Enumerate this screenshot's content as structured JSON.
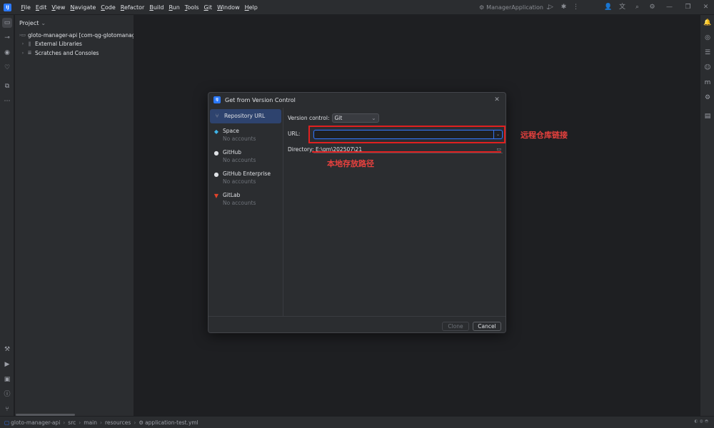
{
  "menu": [
    "File",
    "Edit",
    "View",
    "Navigate",
    "Code",
    "Refactor",
    "Build",
    "Run",
    "Tools",
    "Git",
    "Window",
    "Help"
  ],
  "run_config": "ManagerApplication",
  "project_panel": {
    "title": "Project",
    "tree": [
      {
        "label": "gloto-manager-api [com-qg-glotomanag",
        "icon": "folder-icon"
      },
      {
        "label": "External Libraries",
        "icon": "library-icon"
      },
      {
        "label": "Scratches and Consoles",
        "icon": "scratches-icon"
      }
    ]
  },
  "dialog": {
    "title": "Get from Version Control",
    "sources": [
      {
        "name": "Repository URL",
        "sub": "",
        "icon": "repo-url-icon",
        "selected": true
      },
      {
        "name": "Space",
        "sub": "No accounts",
        "icon": "space-icon"
      },
      {
        "name": "GitHub",
        "sub": "No accounts",
        "icon": "github-icon"
      },
      {
        "name": "GitHub Enterprise",
        "sub": "No accounts",
        "icon": "github-enterprise-icon"
      },
      {
        "name": "GitLab",
        "sub": "No accounts",
        "icon": "gitlab-icon"
      }
    ],
    "version_control_label": "Version control:",
    "version_control_value": "Git",
    "url_label": "URL:",
    "url_value": "",
    "directory_label": "Directory:",
    "directory_value": "E:\\qm\\202507\\21",
    "clone_label": "Clone",
    "cancel_label": "Cancel"
  },
  "annotations": {
    "url_note": "远程仓库链接",
    "dir_note": "本地存放路径"
  },
  "statusbar": {
    "breadcrumbs": [
      "gloto-manager-api",
      "src",
      "main",
      "resources",
      "application-test.yml"
    ]
  },
  "colors": {
    "accent": "#3574f0",
    "selection": "#2e436e",
    "annotation": "#e02020"
  }
}
